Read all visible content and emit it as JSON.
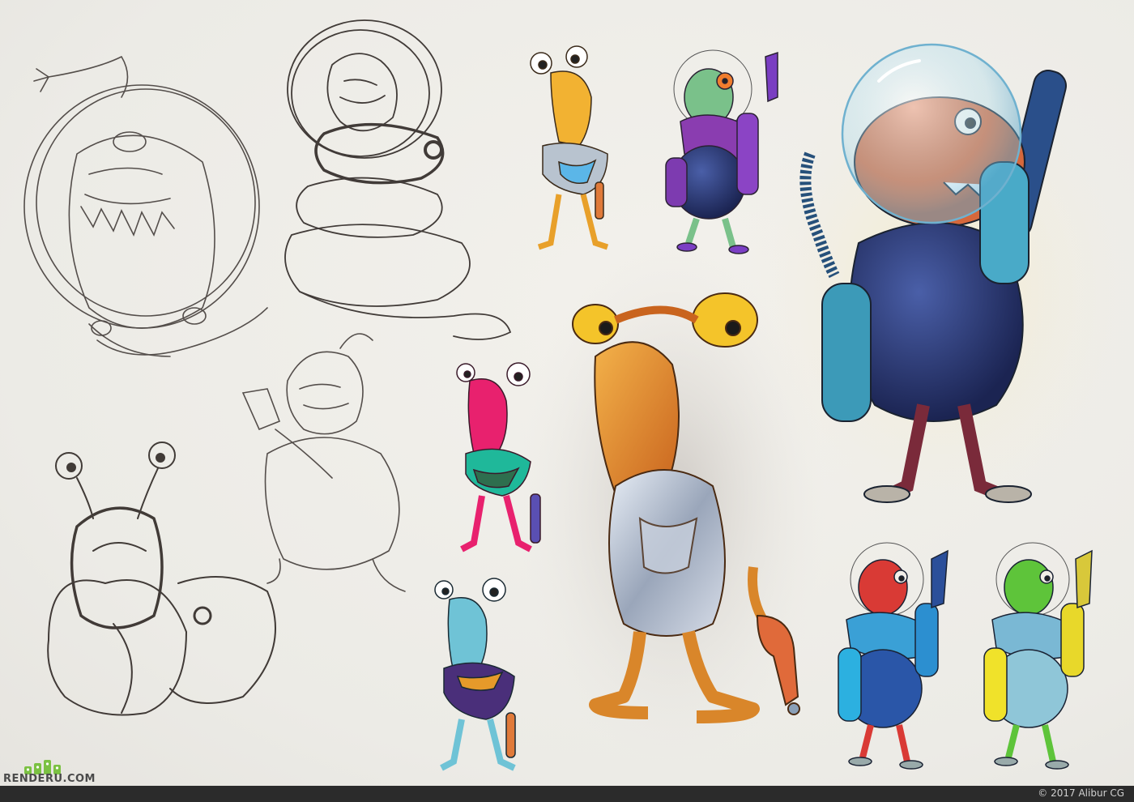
{
  "image": {
    "description_colors": {
      "paper": "#efede8",
      "pencil": "#3a3330",
      "footer_bg": "#2b2b2b",
      "logo_green": "#7bc142"
    }
  },
  "logo": {
    "text": "RENDERU.COM",
    "icon": "renderu-logo-icon"
  },
  "footer": {
    "copyright": "© 2017 Alibur CG"
  }
}
